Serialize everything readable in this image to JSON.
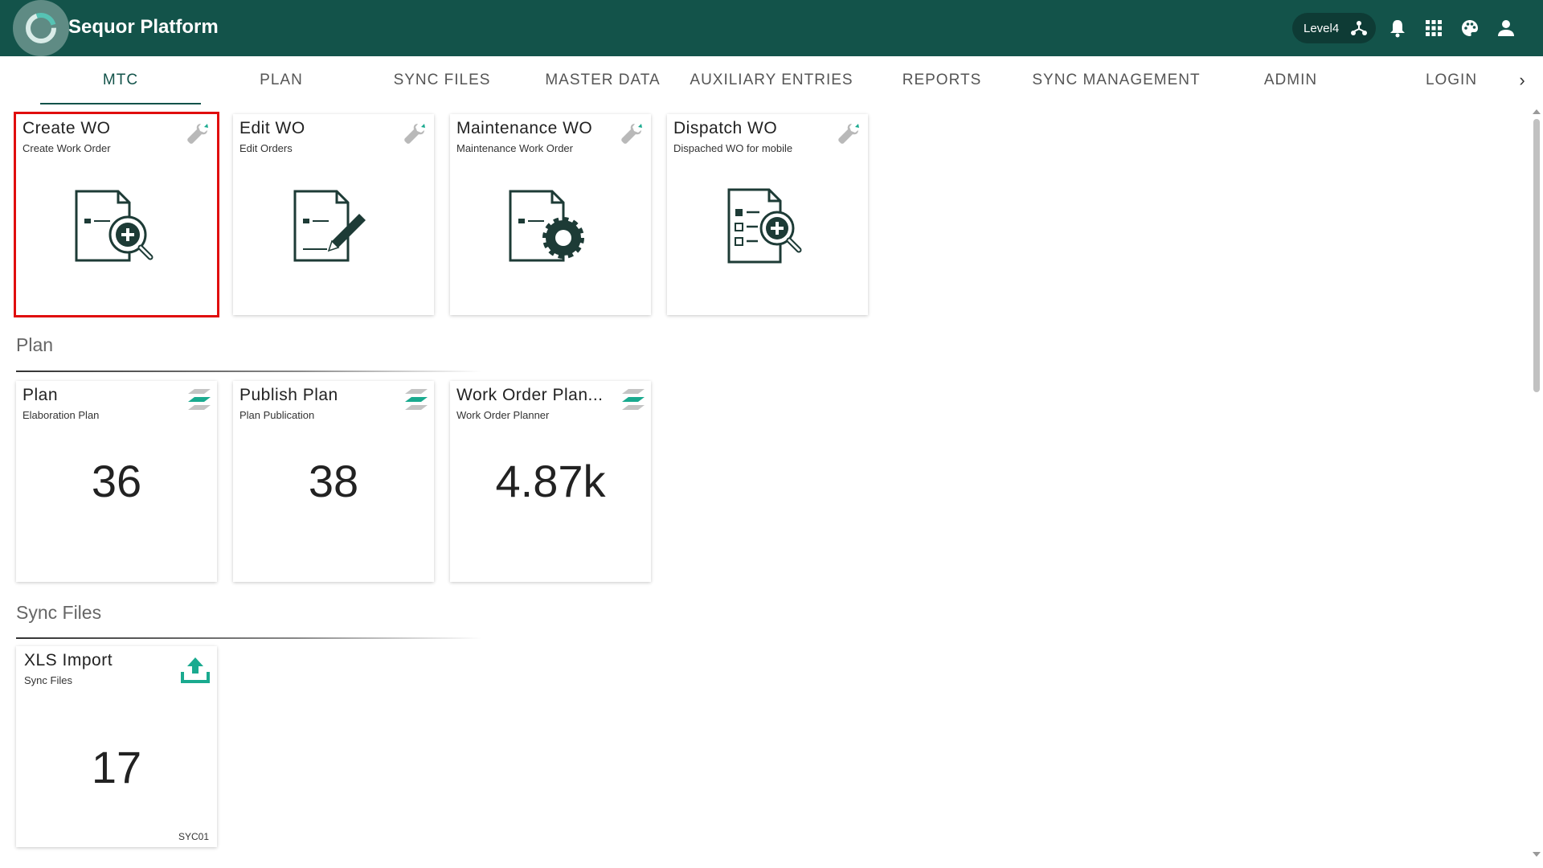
{
  "header": {
    "title": "Sequor Platform",
    "level_label": "Level4"
  },
  "tabs": [
    {
      "label": "MTC",
      "active": true
    },
    {
      "label": "PLAN"
    },
    {
      "label": "SYNC FILES"
    },
    {
      "label": "MASTER DATA"
    },
    {
      "label": "AUXILIARY ENTRIES"
    },
    {
      "label": "REPORTS"
    },
    {
      "label": "SYNC MANAGEMENT"
    },
    {
      "label": "ADMIN"
    },
    {
      "label": "LOGIN"
    }
  ],
  "mtc_cards": [
    {
      "title": "Create WO",
      "subtitle": "Create Work Order",
      "icon": "wrench-icon",
      "illustration": "document-search-plus"
    },
    {
      "title": "Edit WO",
      "subtitle": "Edit Orders",
      "icon": "wrench-icon",
      "illustration": "document-pencil"
    },
    {
      "title": "Maintenance WO",
      "subtitle": "Maintenance Work Order",
      "icon": "wrench-icon",
      "illustration": "document-gear"
    },
    {
      "title": "Dispatch WO",
      "subtitle": "Dispached WO for mobile",
      "icon": "wrench-icon",
      "illustration": "checklist-search-plus"
    }
  ],
  "sections": {
    "plan": {
      "title": "Plan",
      "cards": [
        {
          "title": "Plan",
          "subtitle": "Elaboration Plan",
          "value": "36",
          "icon": "plan-layers-icon"
        },
        {
          "title": "Publish Plan",
          "subtitle": "Plan Publication",
          "value": "38",
          "icon": "plan-layers-icon"
        },
        {
          "title": "Work Order Plan...",
          "subtitle": "Work Order Planner",
          "value": "4.87k",
          "icon": "plan-layers-icon"
        }
      ]
    },
    "sync_files": {
      "title": "Sync Files",
      "cards": [
        {
          "title": "XLS Import",
          "subtitle": "Sync Files",
          "value": "17",
          "code": "SYC01",
          "icon": "upload-icon"
        }
      ]
    }
  },
  "colors": {
    "primary": "#13534a",
    "accent": "#1aaa8f",
    "selection": "#e00d0d",
    "illustration": "#1d3b36"
  }
}
